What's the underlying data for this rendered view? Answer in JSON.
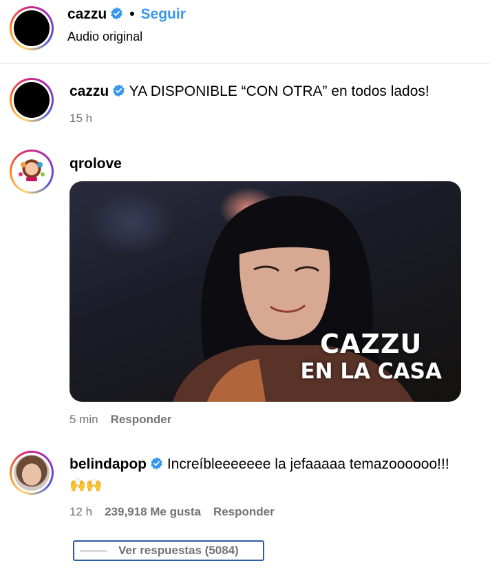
{
  "header": {
    "username": "cazzu",
    "separator": "•",
    "follow_label": "Seguir",
    "subtitle": "Audio original"
  },
  "comments": [
    {
      "username": "cazzu",
      "text": "YA DISPONIBLE “CON OTRA” en todos lados!",
      "time": "15 h"
    },
    {
      "username": "qrolove",
      "gif_text_line1": "CAZZU",
      "gif_text_line2": "EN LA CASA",
      "time": "5 min",
      "reply_label": "Responder"
    },
    {
      "username": "belindapop",
      "text": "Increíbleeeeeee la jefaaaaa temazoooooo!!!",
      "emoji": "🙌🙌",
      "time": "12 h",
      "likes": "239,918 Me gusta",
      "reply_label": "Responder",
      "view_replies": "Ver respuestas (5084)"
    }
  ],
  "colors": {
    "link_blue": "#3897f0",
    "meta_gray": "#737373",
    "verified_blue": "#3797f0",
    "focus_outline": "#2f5aa8"
  },
  "icons": [
    "verified-badge-icon",
    "avatar",
    "gif-image"
  ]
}
